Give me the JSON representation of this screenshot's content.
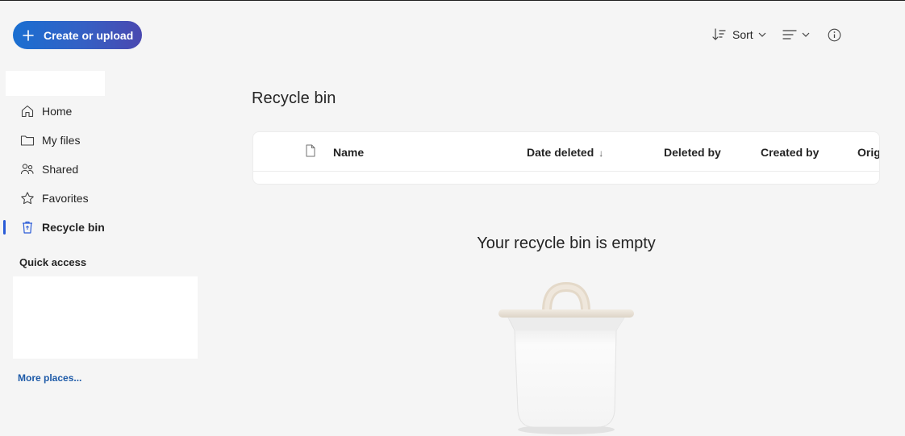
{
  "create_button": {
    "label": "Create or upload"
  },
  "toolbar": {
    "sort_label": "Sort"
  },
  "sidebar": {
    "items": [
      {
        "label": "Home",
        "icon": "home-icon"
      },
      {
        "label": "My files",
        "icon": "folder-icon"
      },
      {
        "label": "Shared",
        "icon": "people-icon"
      },
      {
        "label": "Favorites",
        "icon": "star-icon"
      },
      {
        "label": "Recycle bin",
        "icon": "recycle-bin-icon",
        "active": true
      }
    ],
    "quick_access_title": "Quick access",
    "more_places": "More places..."
  },
  "main": {
    "title": "Recycle bin",
    "columns": [
      "Name",
      "Date deleted",
      "Deleted by",
      "Created by",
      "Orig"
    ],
    "sort_indicator": "↓",
    "empty_message": "Your recycle bin is empty"
  },
  "colors": {
    "accent": "#2a5bd7",
    "link": "#1d5aa8",
    "background": "#f5f5f5"
  }
}
